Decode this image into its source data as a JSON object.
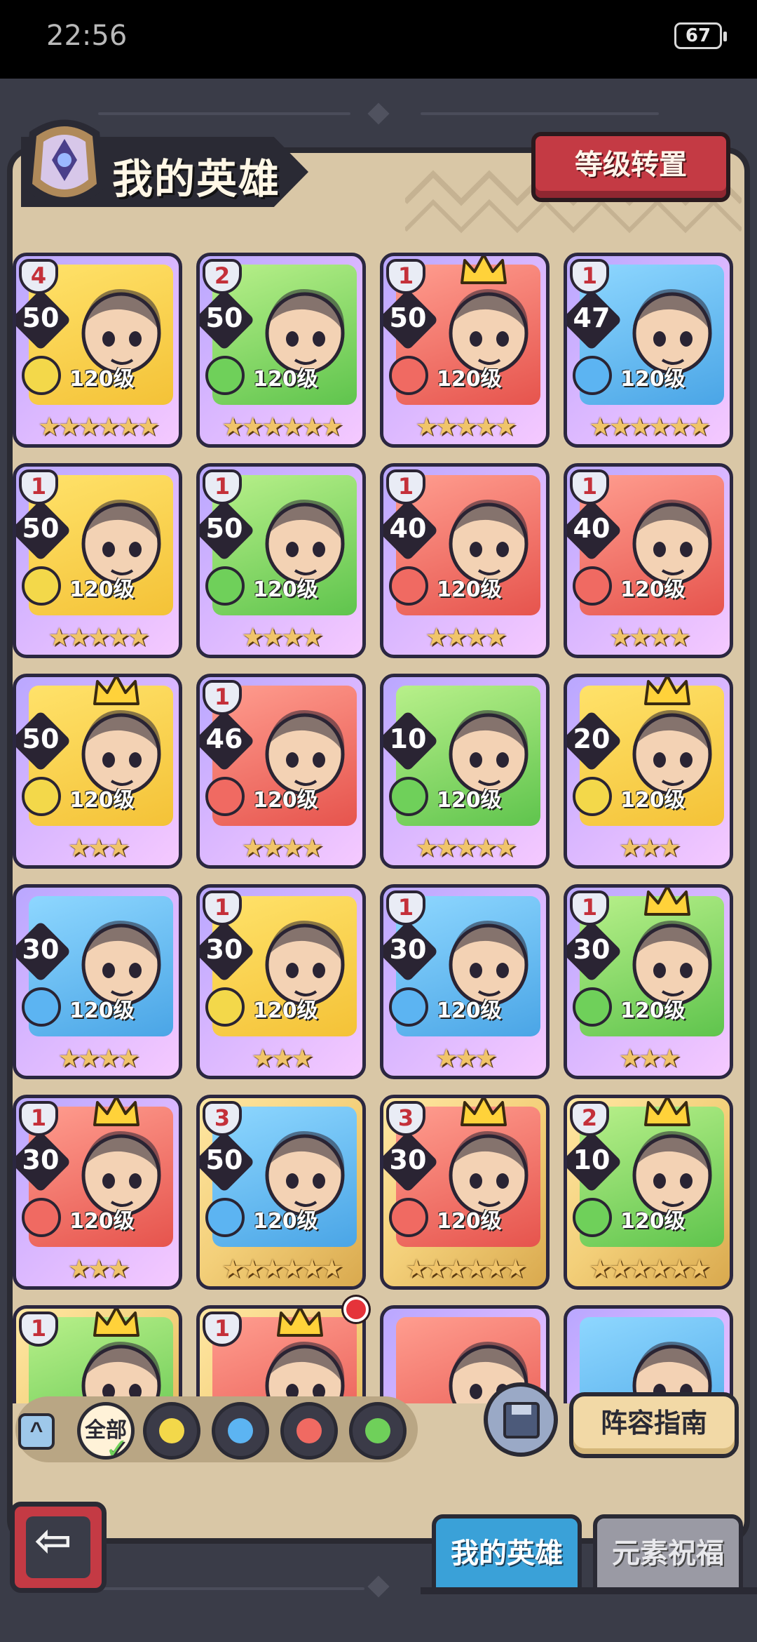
{
  "status_bar": {
    "time": "22:56",
    "battery": "67"
  },
  "header": {
    "title": "我的英雄",
    "transfer_button": "等级转置"
  },
  "heroes": [
    {
      "rank": "4",
      "level": "50",
      "element": "earth",
      "element_icon": "earth-element-icon",
      "max_level": "120级",
      "stars": "★★★★★★",
      "crowned": false,
      "frame": "purple"
    },
    {
      "rank": "2",
      "level": "50",
      "element": "wood",
      "element_icon": "wood-element-icon",
      "max_level": "120级",
      "stars": "★★★★★★",
      "crowned": false,
      "frame": "purple"
    },
    {
      "rank": "1",
      "level": "50",
      "element": "fire",
      "element_icon": "fire-element-icon",
      "max_level": "120级",
      "stars": "★★★★★",
      "crowned": true,
      "frame": "purple"
    },
    {
      "rank": "1",
      "level": "47",
      "element": "water",
      "element_icon": "water-element-icon",
      "max_level": "120级",
      "stars": "★★★★★★",
      "crowned": false,
      "frame": "purple"
    },
    {
      "rank": "1",
      "level": "50",
      "element": "earth",
      "element_icon": "earth-element-icon",
      "max_level": "120级",
      "stars": "★★★★★",
      "crowned": false,
      "frame": "purple"
    },
    {
      "rank": "1",
      "level": "50",
      "element": "wood",
      "element_icon": "wood-element-icon",
      "max_level": "120级",
      "stars": "★★★★",
      "crowned": false,
      "frame": "purple"
    },
    {
      "rank": "1",
      "level": "40",
      "element": "fire",
      "element_icon": "fire-element-icon",
      "max_level": "120级",
      "stars": "★★★★",
      "crowned": false,
      "frame": "purple"
    },
    {
      "rank": "1",
      "level": "40",
      "element": "fire",
      "element_icon": "fire-element-icon",
      "max_level": "120级",
      "stars": "★★★★",
      "crowned": false,
      "frame": "purple"
    },
    {
      "rank": "",
      "level": "50",
      "element": "earth",
      "element_icon": "earth-element-icon",
      "max_level": "120级",
      "stars": "★★★",
      "crowned": true,
      "frame": "purple"
    },
    {
      "rank": "1",
      "level": "46",
      "element": "fire",
      "element_icon": "fire-element-icon",
      "max_level": "120级",
      "stars": "★★★★",
      "crowned": false,
      "frame": "purple"
    },
    {
      "rank": "",
      "level": "10",
      "element": "wood",
      "element_icon": "wood-element-icon",
      "max_level": "120级",
      "stars": "★★★★★",
      "crowned": false,
      "frame": "purple"
    },
    {
      "rank": "",
      "level": "20",
      "element": "earth",
      "element_icon": "earth-element-icon",
      "max_level": "120级",
      "stars": "★★★",
      "crowned": true,
      "frame": "purple"
    },
    {
      "rank": "",
      "level": "30",
      "element": "water",
      "element_icon": "water-element-icon",
      "max_level": "120级",
      "stars": "★★★★",
      "crowned": false,
      "frame": "purple"
    },
    {
      "rank": "1",
      "level": "30",
      "element": "earth",
      "element_icon": "earth-element-icon",
      "max_level": "120级",
      "stars": "★★★",
      "crowned": false,
      "frame": "purple"
    },
    {
      "rank": "1",
      "level": "30",
      "element": "water",
      "element_icon": "water-element-icon",
      "max_level": "120级",
      "stars": "★★★",
      "crowned": false,
      "frame": "purple"
    },
    {
      "rank": "1",
      "level": "30",
      "element": "wood",
      "element_icon": "wood-element-icon",
      "max_level": "120级",
      "stars": "★★★",
      "crowned": true,
      "frame": "purple"
    },
    {
      "rank": "1",
      "level": "30",
      "element": "fire",
      "element_icon": "fire-element-icon",
      "max_level": "120级",
      "stars": "★★★",
      "crowned": true,
      "frame": "purple"
    },
    {
      "rank": "3",
      "level": "50",
      "element": "water",
      "element_icon": "water-element-icon",
      "max_level": "120级",
      "stars": "★★★★★★",
      "crowned": false,
      "frame": "gold"
    },
    {
      "rank": "3",
      "level": "30",
      "element": "fire",
      "element_icon": "fire-element-icon",
      "max_level": "120级",
      "stars": "★★★★★★",
      "crowned": true,
      "frame": "gold"
    },
    {
      "rank": "2",
      "level": "10",
      "element": "wood",
      "element_icon": "wood-element-icon",
      "max_level": "120级",
      "stars": "★★★★★★",
      "crowned": true,
      "frame": "gold"
    },
    {
      "rank": "1",
      "level": "",
      "element": "wood",
      "element_icon": "wood-element-icon",
      "max_level": "",
      "stars": "",
      "crowned": true,
      "frame": "gold"
    },
    {
      "rank": "1",
      "level": "",
      "element": "fire",
      "element_icon": "fire-element-icon",
      "max_level": "",
      "stars": "",
      "crowned": true,
      "frame": "gold",
      "notification": true
    },
    {
      "rank": "",
      "level": "",
      "element": "fire",
      "element_icon": "fire-element-icon",
      "max_level": "",
      "stars": "",
      "crowned": false,
      "frame": "purple"
    },
    {
      "rank": "",
      "level": "",
      "element": "water",
      "element_icon": "water-element-icon",
      "max_level": "",
      "stars": "",
      "crowned": false,
      "frame": "purple"
    }
  ],
  "filter_bar": {
    "collapse_icon": "^",
    "all_label": "全部",
    "elements": [
      "earth",
      "water",
      "fire",
      "wood"
    ]
  },
  "colors": {
    "earth": "#f3d84a",
    "water": "#5cb4f2",
    "fire": "#f06a62",
    "wood": "#6fd05a"
  },
  "bottom": {
    "guide_button": "阵容指南",
    "tab_my_heroes": "我的英雄",
    "tab_blessing": "元素祝福"
  }
}
